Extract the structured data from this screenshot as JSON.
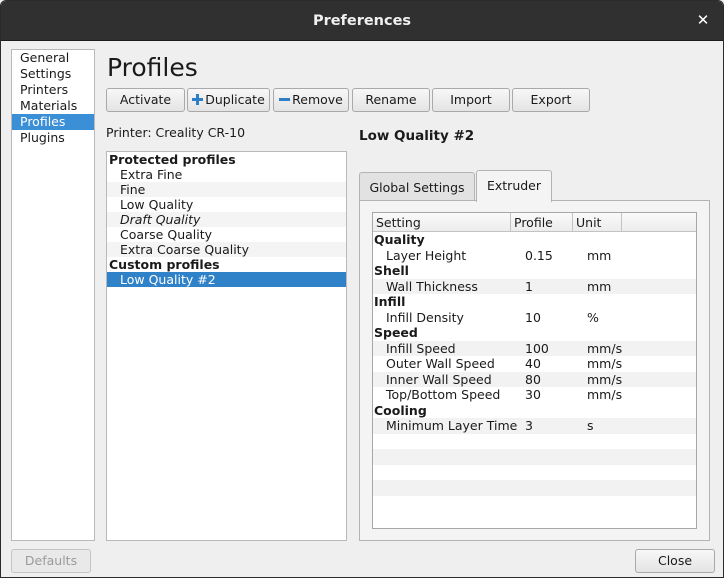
{
  "window": {
    "title": "Preferences",
    "close_glyph": "✕"
  },
  "sidebar": {
    "items": [
      {
        "label": "General"
      },
      {
        "label": "Settings"
      },
      {
        "label": "Printers"
      },
      {
        "label": "Materials"
      },
      {
        "label": "Profiles",
        "selected": true
      },
      {
        "label": "Plugins"
      }
    ]
  },
  "page": {
    "title": "Profiles",
    "printer_label": "Printer: Creality CR-10"
  },
  "toolbar": {
    "activate": "Activate",
    "duplicate": "Duplicate",
    "remove": "Remove",
    "rename": "Rename",
    "import": "Import",
    "export": "Export"
  },
  "profiles": {
    "protected_header": "Protected profiles",
    "protected": [
      "Extra Fine",
      "Fine",
      "Low Quality",
      "Draft Quality",
      "Coarse Quality",
      "Extra Coarse Quality"
    ],
    "custom_header": "Custom profiles",
    "custom": [
      "Low Quality #2"
    ],
    "selected": "Low Quality #2"
  },
  "detail": {
    "profile_name": "Low Quality #2",
    "tabs": [
      "Global Settings",
      "Extruder"
    ],
    "active_tab": "Extruder",
    "columns": [
      "Setting",
      "Profile",
      "Unit"
    ],
    "categories": [
      {
        "name": "Quality",
        "rows": [
          {
            "setting": "Layer Height",
            "value": "0.15",
            "unit": "mm"
          }
        ]
      },
      {
        "name": "Shell",
        "rows": [
          {
            "setting": "Wall Thickness",
            "value": "1",
            "unit": "mm"
          }
        ]
      },
      {
        "name": "Infill",
        "rows": [
          {
            "setting": "Infill Density",
            "value": "10",
            "unit": "%"
          }
        ]
      },
      {
        "name": "Speed",
        "rows": [
          {
            "setting": "Infill Speed",
            "value": "100",
            "unit": "mm/s"
          },
          {
            "setting": "Outer Wall Speed",
            "value": "40",
            "unit": "mm/s"
          },
          {
            "setting": "Inner Wall Speed",
            "value": "80",
            "unit": "mm/s"
          },
          {
            "setting": "Top/Bottom Speed",
            "value": "30",
            "unit": "mm/s"
          }
        ]
      },
      {
        "name": "Cooling",
        "rows": [
          {
            "setting": "Minimum Layer Time",
            "value": "3",
            "unit": "s"
          }
        ]
      }
    ]
  },
  "footer": {
    "defaults": "Defaults",
    "close": "Close"
  },
  "colors": {
    "titlebar": "#303030",
    "selection": "#2f82c8",
    "sidebar_selection": "#3a8fd6",
    "background": "#efefef"
  }
}
